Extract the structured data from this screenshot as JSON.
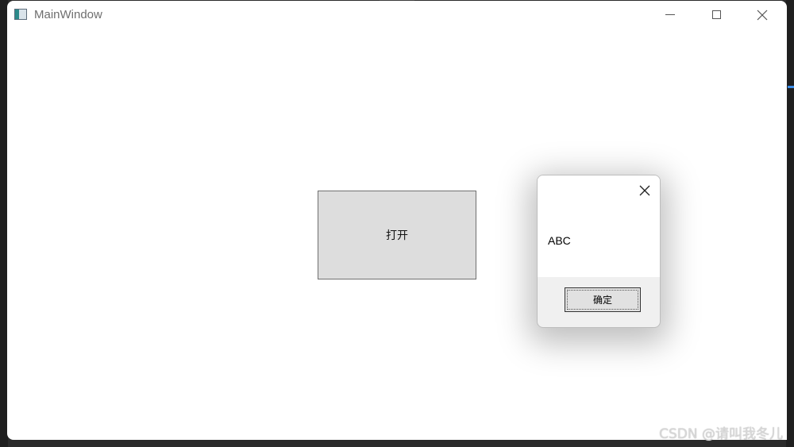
{
  "window": {
    "title": "MainWindow"
  },
  "main": {
    "open_button_label": "打开"
  },
  "dialog": {
    "message": "ABC",
    "ok_label": "确定"
  },
  "watermark": "CSDN @请叫我冬儿",
  "colors": {
    "window_bg": "#ffffff",
    "button_bg": "#dddddd",
    "dialog_footer_bg": "#f0f0f0",
    "backdrop": "#2b2b2b"
  },
  "icons": [
    "window-app-icon",
    "minimize-icon",
    "maximize-icon",
    "close-icon",
    "dialog-close-icon"
  ]
}
